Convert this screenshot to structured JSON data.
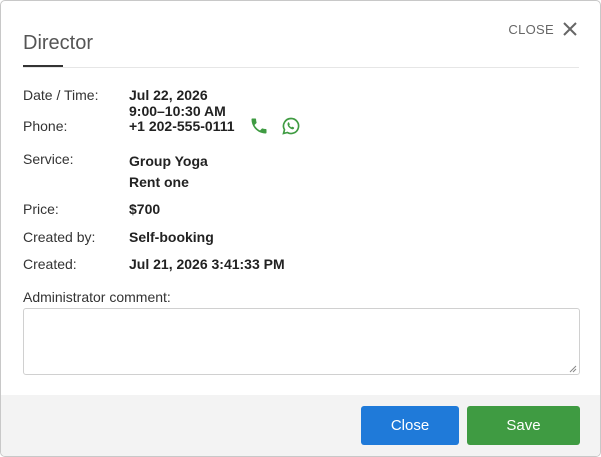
{
  "dialog": {
    "title": "Director",
    "close_label": "CLOSE"
  },
  "details": {
    "date_label": "Date / Time:",
    "date_value": "Jul 22, 2026",
    "time_value": "9:00–10:30 AM",
    "phone_label": "Phone:",
    "phone_value": "+1 202-555-0111",
    "service_label": "Service:",
    "service_lines": [
      "Group Yoga",
      "Rent one"
    ],
    "price_label": "Price:",
    "price_value": "$700",
    "created_by_label": "Created by:",
    "created_by_value": "Self-booking",
    "created_label": "Created:",
    "created_value": "Jul 21, 2026 3:41:33 PM"
  },
  "comment": {
    "label": "Administrator comment:",
    "value": ""
  },
  "footer": {
    "close_button": "Close",
    "save_button": "Save"
  },
  "icons": {
    "phone": "phone-icon",
    "whatsapp": "whatsapp-icon",
    "close": "close-icon",
    "icon_color": "#3f9b42"
  }
}
